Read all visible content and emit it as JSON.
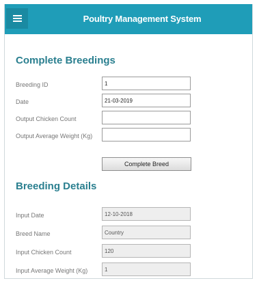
{
  "header": {
    "title": "Poultry Management System",
    "menu_icon": "hamburger-menu-icon"
  },
  "complete_breedings": {
    "title": "Complete Breedings",
    "fields": [
      {
        "label": "Breeding ID",
        "value": "1"
      },
      {
        "label": "Date",
        "value": "21-03-2019"
      },
      {
        "label": "Output Chicken Count",
        "value": ""
      },
      {
        "label": "Output Average Weight (Kg)",
        "value": ""
      }
    ],
    "button_label": "Complete Breed"
  },
  "breeding_details": {
    "title": "Breeding Details",
    "fields": [
      {
        "label": "Input Date",
        "value": "12-10-2018"
      },
      {
        "label": "Breed Name",
        "value": "Country"
      },
      {
        "label": "Input Chicken Count",
        "value": "120"
      },
      {
        "label": "Input Average Weight (Kg)",
        "value": "1"
      }
    ]
  },
  "colors": {
    "header": "#1f9db8",
    "section_title": "#2a7f8f"
  }
}
